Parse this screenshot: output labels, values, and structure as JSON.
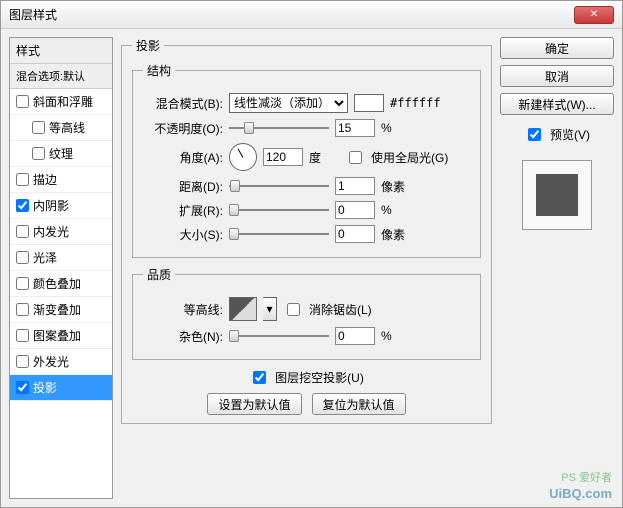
{
  "window": {
    "title": "图层样式"
  },
  "sidebar": {
    "header": "样式",
    "subheader": "混合选项:默认",
    "items": [
      {
        "label": "斜面和浮雕",
        "checked": false,
        "indent": false
      },
      {
        "label": "等高线",
        "checked": false,
        "indent": true
      },
      {
        "label": "纹理",
        "checked": false,
        "indent": true
      },
      {
        "label": "描边",
        "checked": false,
        "indent": false
      },
      {
        "label": "内阴影",
        "checked": true,
        "indent": false
      },
      {
        "label": "内发光",
        "checked": false,
        "indent": false
      },
      {
        "label": "光泽",
        "checked": false,
        "indent": false
      },
      {
        "label": "颜色叠加",
        "checked": false,
        "indent": false
      },
      {
        "label": "渐变叠加",
        "checked": false,
        "indent": false
      },
      {
        "label": "图案叠加",
        "checked": false,
        "indent": false
      },
      {
        "label": "外发光",
        "checked": false,
        "indent": false
      },
      {
        "label": "投影",
        "checked": true,
        "indent": false,
        "selected": true
      }
    ]
  },
  "panel": {
    "title": "投影",
    "structure": {
      "legend": "结构",
      "blend_label": "混合模式(B):",
      "blend_value": "线性减淡（添加）",
      "color_hex": "#ffffff",
      "opacity_label": "不透明度(O):",
      "opacity_value": "15",
      "opacity_unit": "%",
      "angle_label": "角度(A):",
      "angle_value": "120",
      "angle_unit": "度",
      "global_light_label": "使用全局光(G)",
      "global_light_checked": false,
      "distance_label": "距离(D):",
      "distance_value": "1",
      "distance_unit": "像素",
      "spread_label": "扩展(R):",
      "spread_value": "0",
      "spread_unit": "%",
      "size_label": "大小(S):",
      "size_value": "0",
      "size_unit": "像素"
    },
    "quality": {
      "legend": "品质",
      "contour_label": "等高线:",
      "antialias_label": "消除锯齿(L)",
      "antialias_checked": false,
      "noise_label": "杂色(N):",
      "noise_value": "0",
      "noise_unit": "%"
    },
    "knockout_label": "图层挖空投影(U)",
    "knockout_checked": true,
    "default_btn": "设置为默认值",
    "reset_btn": "复位为默认值"
  },
  "buttons": {
    "ok": "确定",
    "cancel": "取消",
    "newstyle": "新建样式(W)...",
    "preview_label": "预览(V)",
    "preview_checked": true
  },
  "watermark": {
    "line1": "PS 爱好者",
    "line2": "UiBQ.com"
  }
}
